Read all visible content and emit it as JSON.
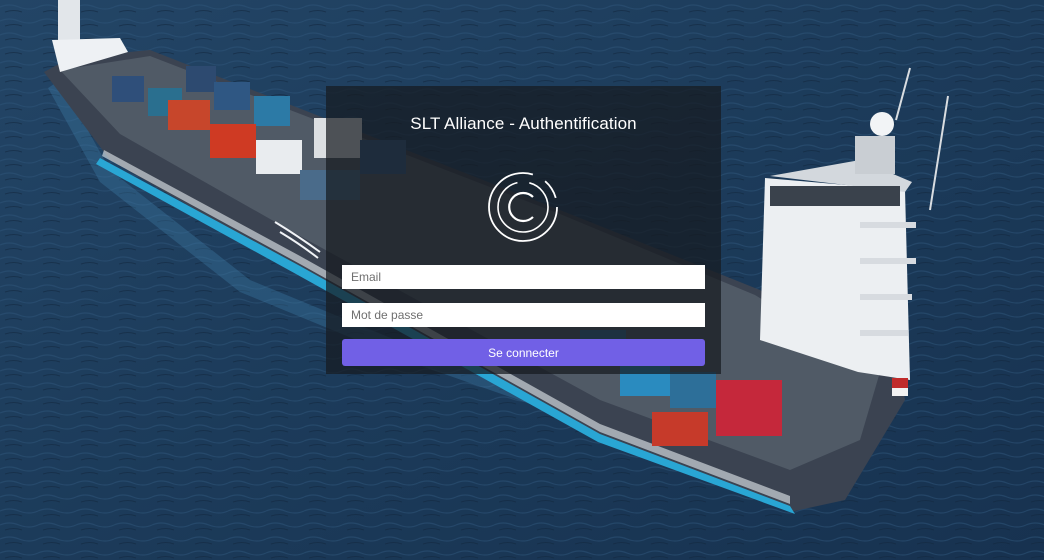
{
  "login": {
    "title": "SLT Alliance - Authentification",
    "email_placeholder": "Email",
    "password_placeholder": "Mot de passe",
    "submit_label": "Se connecter"
  },
  "colors": {
    "button": "#7160e6",
    "card_overlay": "rgba(22, 26, 32, 0.72)",
    "sea": "#1c3a58"
  },
  "icons": {
    "logo": "circular-c-logo-icon",
    "background": "cargo-ship-aerial-photo"
  }
}
